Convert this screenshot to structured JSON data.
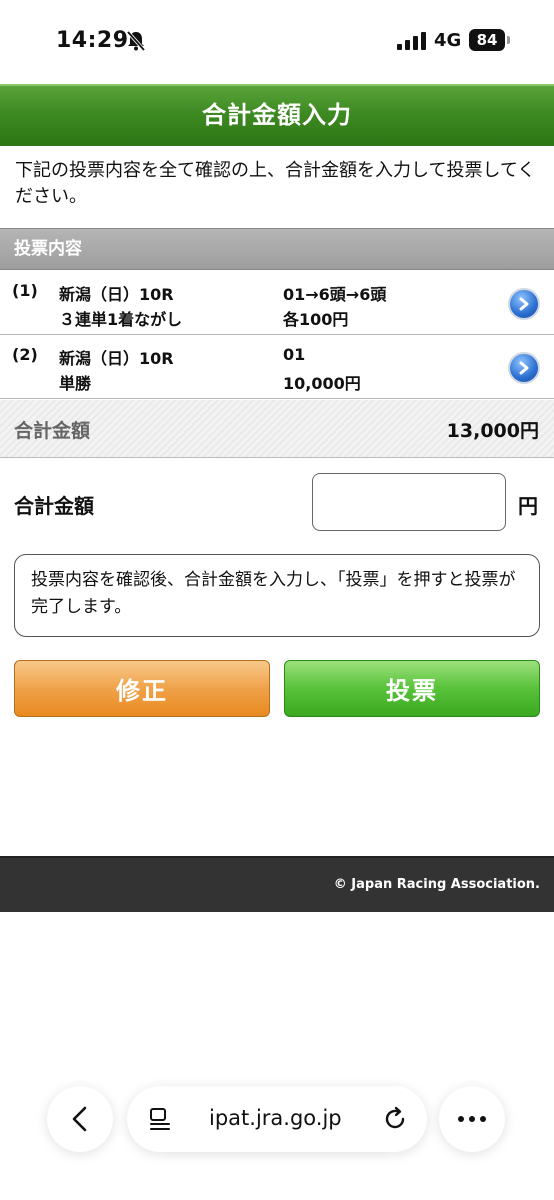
{
  "status_bar": {
    "time": "14:29",
    "network": "4G",
    "battery": "84"
  },
  "header": {
    "title": "合計金額入力"
  },
  "intro": "下記の投票内容を全て確認の上、合計金額を入力して投票してください。",
  "section": {
    "title": "投票内容"
  },
  "bets": [
    {
      "num": "(1)",
      "race": "新潟（日）10R",
      "type": "３連単1着ながし",
      "combo": "01→6頭→6頭",
      "amount": "各100円"
    },
    {
      "num": "(2)",
      "race": "新潟（日）10R",
      "type": "単勝",
      "combo": "01",
      "amount": "10,000円"
    }
  ],
  "total": {
    "label": "合計金額",
    "value": "13,000円"
  },
  "input": {
    "label": "合計金額",
    "unit": "円",
    "value": ""
  },
  "notice": "投票内容を確認後、合計金額を入力し、「投票」を押すと投票が完了します。",
  "buttons": {
    "fix": "修正",
    "vote": "投票"
  },
  "footer": {
    "copyright": "© Japan Racing Association."
  },
  "browser": {
    "url": "ipat.jra.go.jp"
  },
  "colors": {
    "header_green": "#3e8a22",
    "fix_orange": "#f0a24a",
    "vote_green": "#58c23a",
    "footer_dark": "#333333"
  },
  "icons": [
    "bell-slash-icon",
    "signal-icon",
    "chevron-right-icon",
    "back-icon",
    "reader-icon",
    "reload-icon",
    "more-icon"
  ]
}
